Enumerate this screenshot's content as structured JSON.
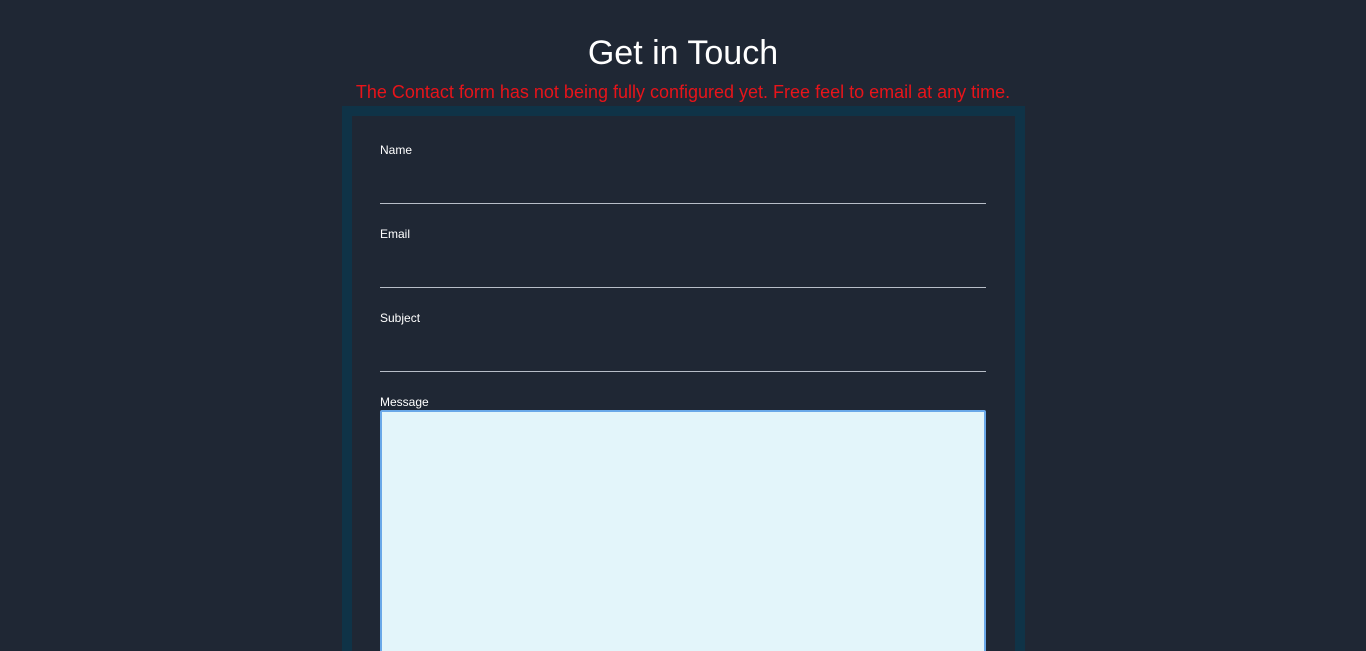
{
  "header": {
    "title": "Get in Touch",
    "warning": "The Contact form has not being fully configured yet. Free feel to email at any time."
  },
  "form": {
    "name_label": "Name",
    "name_value": "",
    "email_label": "Email",
    "email_value": "",
    "subject_label": "Subject",
    "subject_value": "",
    "message_label": "Message",
    "message_value": ""
  },
  "colors": {
    "background": "#1f2734",
    "frame": "#0f3347",
    "warning": "#e8141a",
    "message_bg": "#e3f5fa",
    "focus_border": "#6aa8e8"
  }
}
